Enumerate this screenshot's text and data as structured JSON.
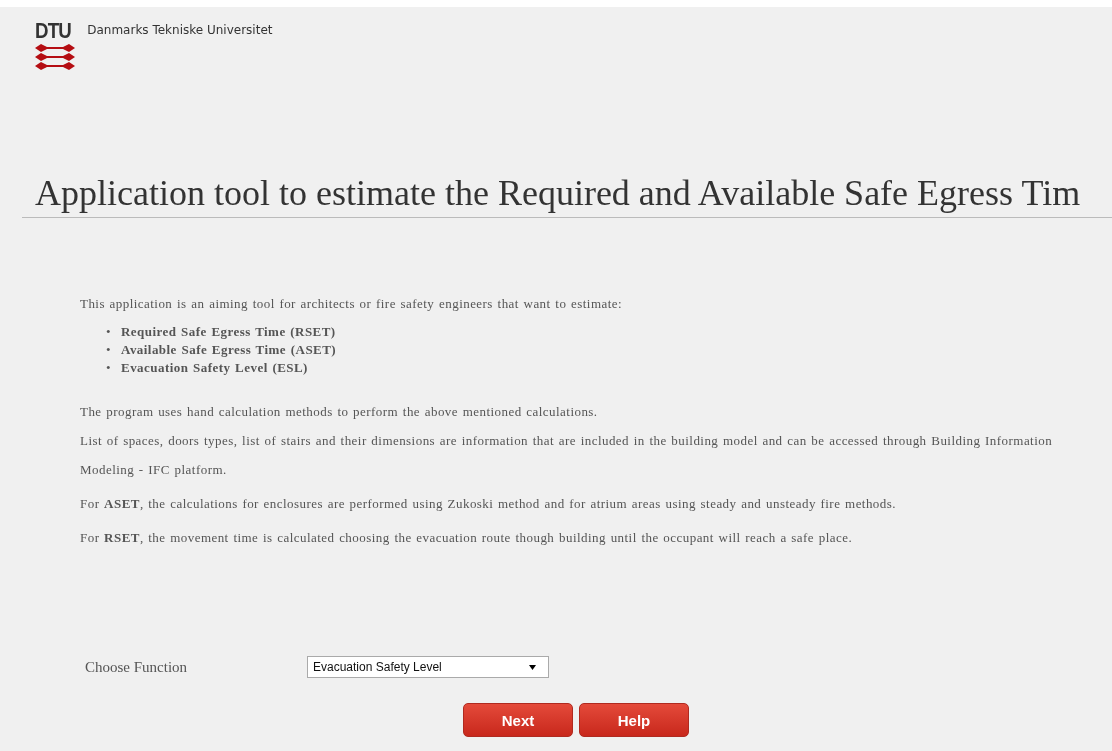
{
  "header": {
    "logo_text": "DTU",
    "university": "Danmarks Tekniske Universitet"
  },
  "title": "Application tool to estimate the Required and Available Safe Egress Tim",
  "intro": "This application is an aiming tool for architects or fire safety engineers that want to estimate:",
  "bullets": [
    {
      "marker": "•",
      "text": "Required Safe Egress Time (RSET)"
    },
    {
      "marker": "•",
      "text": "Available Safe Egress Time (ASET)"
    },
    {
      "marker": "•",
      "text": "Evacuation Safety Level (ESL)"
    }
  ],
  "paragraphs": [
    "The program uses hand calculation methods to perform the above mentioned calculations.",
    "List of spaces, doors types, list of stairs and their dimensions are information that are included in the building model and can be accessed through Building Information Modeling - IFC platform.",
    "For **ASET**, the calculations for enclosures are performed using Zukoski method and for atrium areas using steady and unsteady fire methods.",
    "For **RSET**, the movement time is calculated choosing the evacuation route though building until the occupant will reach a safe place."
  ],
  "form": {
    "label": "Choose Function",
    "select_value": "Evacuation Safety Level"
  },
  "buttons": [
    "Next",
    "Help"
  ]
}
